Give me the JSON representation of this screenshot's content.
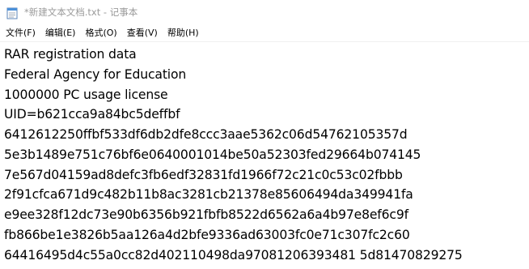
{
  "window": {
    "title": "*新建文本文档.txt - 记事本",
    "icon": "notepad-icon"
  },
  "menu": [
    {
      "id": "file",
      "label": "文件(F)"
    },
    {
      "id": "edit",
      "label": "编辑(E)"
    },
    {
      "id": "format",
      "label": "格式(O)"
    },
    {
      "id": "view",
      "label": "查看(V)"
    },
    {
      "id": "help",
      "label": "帮助(H)"
    }
  ],
  "editor": {
    "lines": [
      "RAR registration data",
      "Federal Agency for Education",
      "1000000 PC usage license",
      "UID=b621cca9a84bc5deffbf",
      "6412612250ffbf533df6db2dfe8ccc3aae5362c06d54762105357d",
      "5e3b1489e751c76bf6e0640001014be50a52303fed29664b074145",
      "7e567d04159ad8defc3fb6edf32831fd1966f72c21c0c53c02fbbb",
      "2f91cfca671d9c482b11b8ac3281cb21378e85606494da349941fa",
      "e9ee328f12dc73e90b6356b921fbfb8522d6562a6a4b97e8ef6c9f",
      "fb866be1e3826b5aa126a4d2bfe9336ad63003fc0e71c307fc2c60",
      "64416495d4c55a0cc82d402110498da97081206393481 5d81470829275"
    ]
  }
}
